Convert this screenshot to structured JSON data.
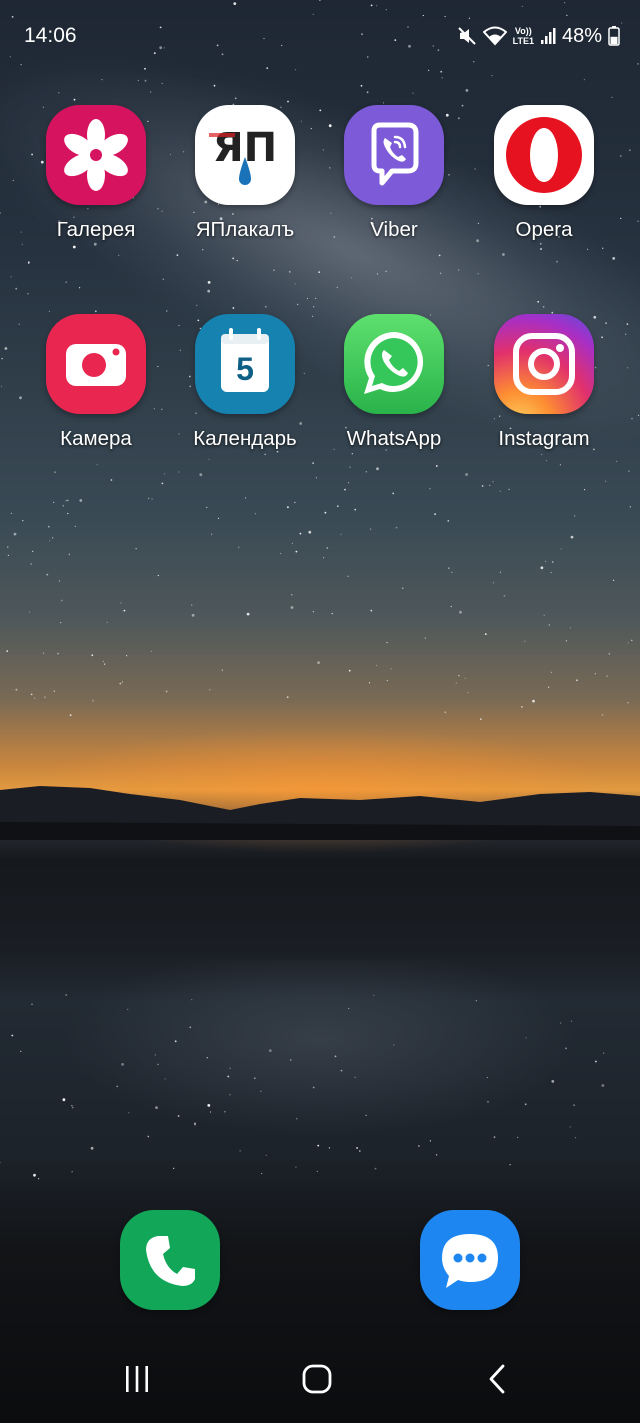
{
  "status_bar": {
    "time": "14:06",
    "volte_top": "Vo))",
    "volte_bottom": "LTE1",
    "battery_text": "48%",
    "battery_level": 0.48,
    "icons": [
      "mute-icon",
      "wifi-icon",
      "volte-icon",
      "signal-icon",
      "battery-icon"
    ]
  },
  "apps": [
    {
      "label": "Галерея",
      "icon": "gallery-icon",
      "color": "#d6135f"
    },
    {
      "label": "ЯПлакалъ",
      "icon": "yaplakal-icon",
      "color": "#ffffff",
      "icon_text": "ЯП"
    },
    {
      "label": "Viber",
      "icon": "viber-icon",
      "color": "#7d5ad8"
    },
    {
      "label": "Opera",
      "icon": "opera-icon",
      "color": "#ffffff"
    },
    {
      "label": "Камера",
      "icon": "camera-icon",
      "color": "#e8264f"
    },
    {
      "label": "Календарь",
      "icon": "calendar-icon",
      "color": "#1582b0",
      "icon_text": "5"
    },
    {
      "label": "WhatsApp",
      "icon": "whatsapp-icon",
      "color": "#35c75a"
    },
    {
      "label": "Instagram",
      "icon": "instagram-icon",
      "color": "#e1306c"
    }
  ],
  "dock": [
    {
      "name": "phone",
      "icon": "phone-icon",
      "color": "#12a659"
    },
    {
      "name": "messages",
      "icon": "messages-icon",
      "color": "#1e86f0"
    }
  ],
  "nav": [
    "recent-apps-icon",
    "home-icon",
    "back-icon"
  ]
}
